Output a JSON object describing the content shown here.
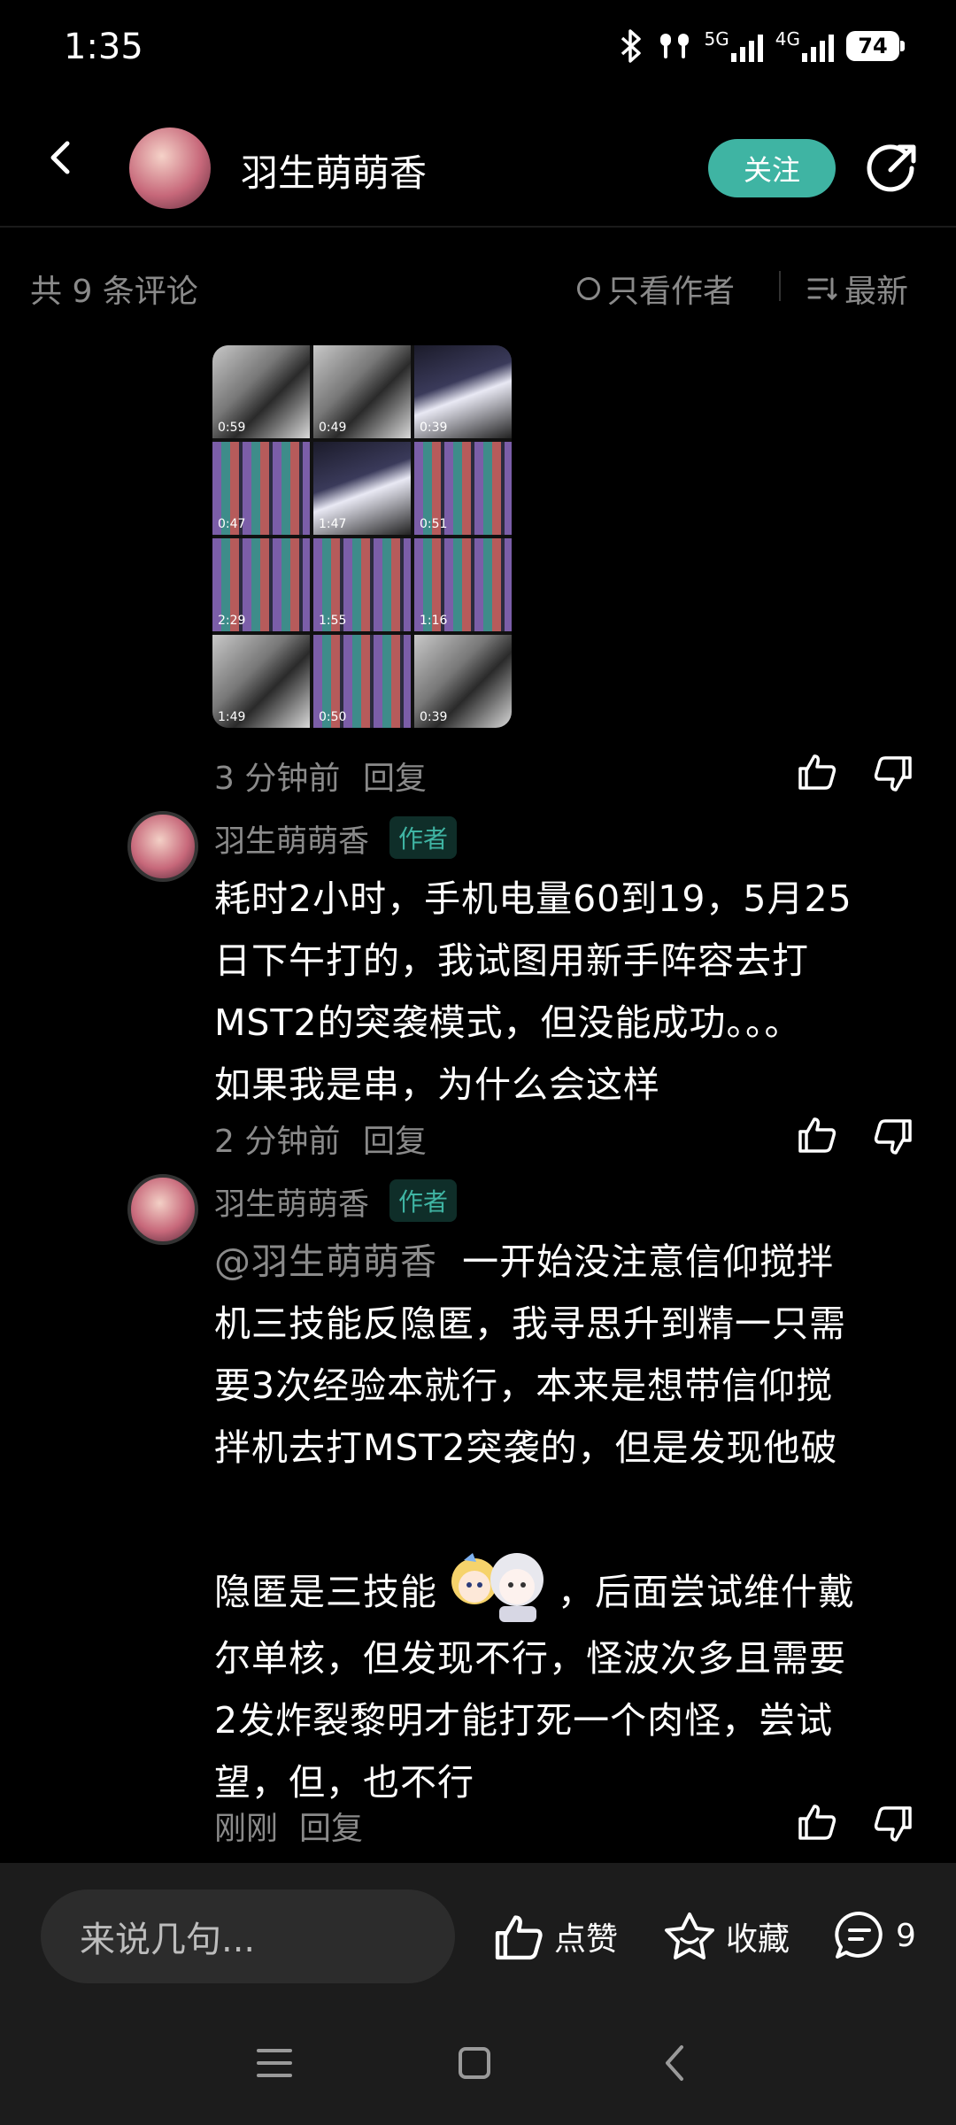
{
  "status_bar": {
    "time": "1:35",
    "signal_5g": "5G",
    "signal_4g": "4G",
    "battery": "74"
  },
  "header": {
    "title": "羽生萌萌香",
    "follow_label": "关注"
  },
  "filter": {
    "count": "共 9 条评论",
    "only_author": "只看作者",
    "sort": "最新"
  },
  "image_post": {
    "durations": [
      "0:59",
      "0:49",
      "0:39",
      "1:49",
      "0:50",
      "0:39",
      "0:47",
      "1:47",
      "0:51",
      "2:29",
      "1:55",
      "1:16",
      "",
      "",
      ""
    ],
    "time": "3 分钟前",
    "reply_label": "回复"
  },
  "comments": [
    {
      "user": "羽生萌萌香",
      "badge": "作者",
      "lines": [
        "耗时2小时，手机电量60到19，5月25",
        "日下午打的，我试图用新手阵容去打",
        "MST2的突袭模式，但没能成功。。。",
        "如果我是串，为什么会这样"
      ],
      "time": "2 分钟前",
      "reply_label": "回复"
    },
    {
      "user": "羽生萌萌香",
      "badge": "作者",
      "mention": "@羽生萌萌香",
      "line1": "一开始没注意信仰搅拌",
      "lines": [
        "机三技能反隐匿，我寻思升到精一只需",
        "要3次经验本就行，本来是想带信仰搅",
        "拌机去打MST2突袭的，但是发现他破"
      ],
      "sticker_line_pre": "隐匿是三技能",
      "sticker_line_post": "，后面尝试维什戴",
      "lines2": [
        "尔单核，但发现不行，怪波次多且需要",
        "2发炸裂黎明才能打死一个肉怪，尝试",
        "望，但，也不行"
      ],
      "time": "刚刚",
      "reply_label": "回复"
    }
  ],
  "bottom_bar": {
    "input_placeholder": "来说几句...",
    "like_label": "点赞",
    "collect_label": "收藏",
    "comment_count": "9"
  },
  "colors": {
    "accent": "#3fb4a3",
    "background": "#000000",
    "muted": "#8a8a8a"
  }
}
